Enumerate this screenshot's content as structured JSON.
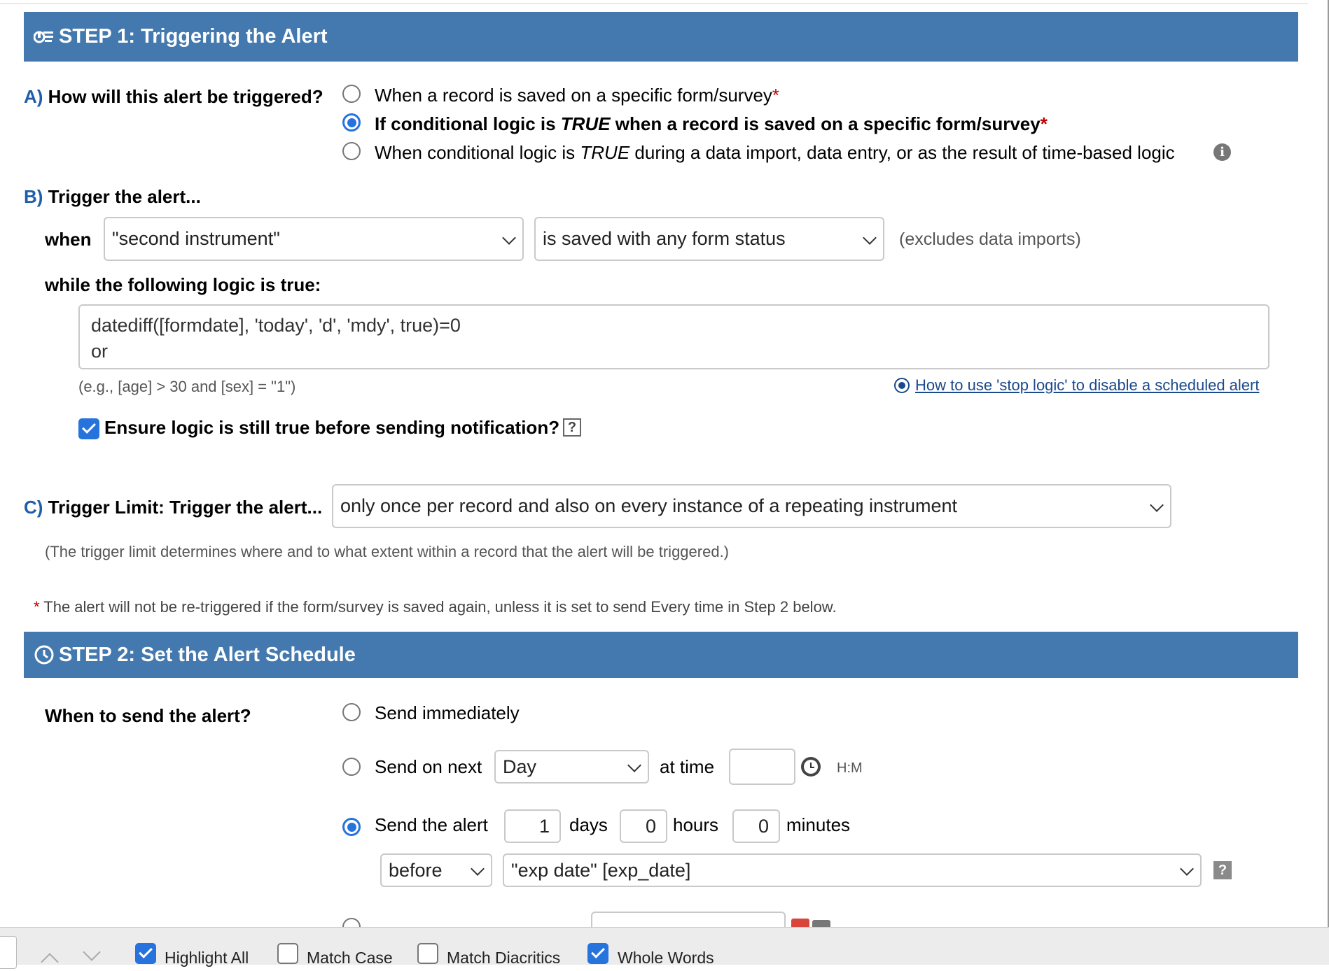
{
  "step1": {
    "title": "STEP 1: Triggering the Alert",
    "icon": "alert-trigger-icon"
  },
  "sectionA": {
    "letter": "A)",
    "label": "How will this alert be triggered?",
    "options": [
      {
        "pre": "When a record is saved on a specific form/survey",
        "star": "*",
        "selected": false
      },
      {
        "pre": "If conditional logic is ",
        "em": "TRUE",
        "post": " when a record is saved on a specific form/survey",
        "star": "*",
        "selected": true
      },
      {
        "pre": "When conditional logic is ",
        "em": "TRUE",
        "post": " during a data import, data entry, or as the result of time-based logic",
        "selected": false
      }
    ]
  },
  "sectionB": {
    "letter": "B)",
    "label": "Trigger the alert...",
    "when_label": "when",
    "instrument_value": "\"second instrument\"",
    "status_value": "is saved with any form status",
    "excludes_note": "(excludes data imports)",
    "logic_label": "while the following logic is true:",
    "logic_value": "datediff([formdate], 'today', 'd', 'mdy', true)=0\nor",
    "logic_example": "(e.g., [age] > 30 and [sex] = \"1\")",
    "stop_logic_link": "How to use 'stop logic' to disable a scheduled alert",
    "ensure_label": "Ensure logic is still true before sending notification?",
    "ensure_checked": true,
    "help_glyph": "?"
  },
  "sectionC": {
    "letter": "C)",
    "label": "Trigger Limit: Trigger the alert...",
    "limit_value": "only once per record and also on every instance of a repeating instrument",
    "note": "(The trigger limit determines where and to what extent within a record that the alert will be triggered.)"
  },
  "footnote": {
    "star": "*",
    "text": "The alert will not be re-triggered if the form/survey is saved again, unless it is set to send Every time in Step 2 below."
  },
  "step2": {
    "title": "STEP 2: Set the Alert Schedule",
    "icon": "clock-icon",
    "when_label": "When to send the alert?",
    "send_immediately": "Send immediately",
    "send_on_next": "Send on next",
    "next_value": "Day",
    "at_time": "at time",
    "time_value": "",
    "time_format": "H:M",
    "send_the_alert": "Send the alert",
    "days_value": "1",
    "days_label": "days",
    "hours_value": "0",
    "hours_label": "hours",
    "minutes_value": "0",
    "minutes_label": "minutes",
    "before_value": "before",
    "field_value": "\"exp date\" [exp_date]",
    "help_glyph": "?",
    "selected_option": "send_the_alert"
  },
  "findbar": {
    "highlight_all": "Highlight All",
    "highlight_all_checked": true,
    "match_case": "Match Case",
    "match_case_checked": false,
    "match_diacritics": "Match Diacritics",
    "match_diacritics_checked": false,
    "whole_words": "Whole Words",
    "whole_words_checked": true
  }
}
